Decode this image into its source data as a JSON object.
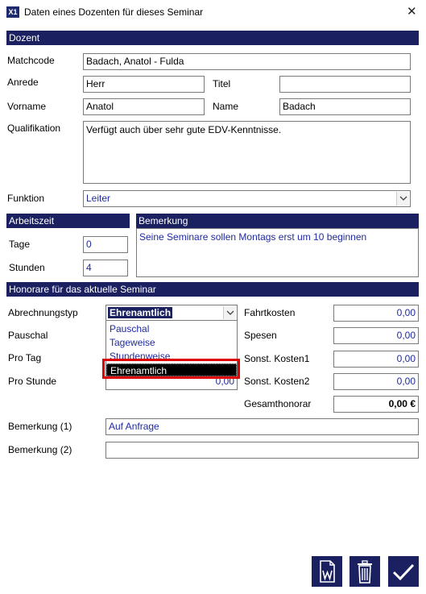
{
  "window": {
    "title": "Daten eines Dozenten für dieses Seminar",
    "app_icon": "app-logo-icon",
    "close_icon": "close-icon"
  },
  "dozent": {
    "header": "Dozent",
    "matchcode_label": "Matchcode",
    "matchcode_value": "Badach, Anatol - Fulda",
    "anrede_label": "Anrede",
    "anrede_value": "Herr",
    "titel_label": "Titel",
    "titel_value": "",
    "vorname_label": "Vorname",
    "vorname_value": "Anatol",
    "name_label": "Name",
    "name_value": "Badach",
    "qualifikation_label": "Qualifikation",
    "qualifikation_value": "Verfügt auch über sehr gute EDV-Kenntnisse.",
    "funktion_label": "Funktion",
    "funktion_value": "Leiter"
  },
  "arbeitszeit": {
    "header": "Arbeitszeit",
    "tage_label": "Tage",
    "tage_value": "0",
    "stunden_label": "Stunden",
    "stunden_value": "4"
  },
  "bemerkung": {
    "header": "Bemerkung",
    "value": "Seine Seminare sollen Montags erst um 10 beginnen"
  },
  "honorare": {
    "header": "Honorare für das aktuelle Seminar",
    "abrechnungstyp_label": "Abrechnungstyp",
    "abrechnungstyp_value": "Ehrenamtlich",
    "pauschal_label": "Pauschal",
    "pro_tag_label": "Pro Tag",
    "pro_stunde_label": "Pro Stunde",
    "pro_stunde_value": "0,00",
    "options": [
      "Pauschal",
      "Tageweise",
      "Stundenweise",
      "Ehrenamtlich"
    ],
    "fahrtkosten_label": "Fahrtkosten",
    "fahrtkosten_value": "0,00",
    "spesen_label": "Spesen",
    "spesen_value": "0,00",
    "sonst1_label": "Sonst. Kosten1",
    "sonst1_value": "0,00",
    "sonst2_label": "Sonst. Kosten2",
    "sonst2_value": "0,00",
    "gesamt_label": "Gesamthonorar",
    "gesamt_value": "0,00 €"
  },
  "bemerkungen": {
    "b1_label": "Bemerkung (1)",
    "b1_value": "Auf Anfrage",
    "b2_label": "Bemerkung (2)",
    "b2_value": ""
  },
  "buttons": {
    "word": "word-document-icon",
    "delete": "trash-icon",
    "ok": "checkmark-icon"
  },
  "colors": {
    "header_bg": "#1a2060",
    "field_text": "#1f2aa0",
    "highlight": "#e00000"
  }
}
